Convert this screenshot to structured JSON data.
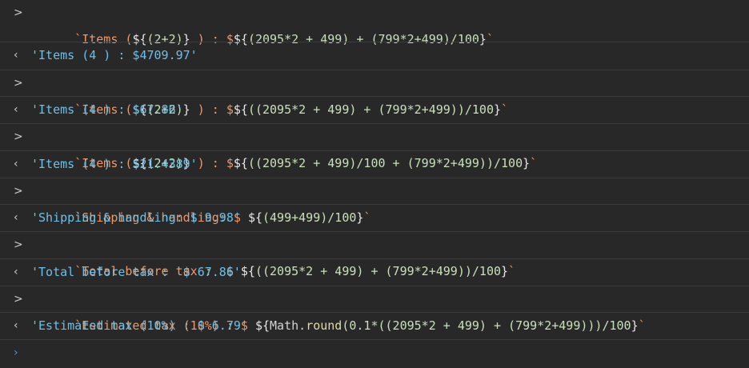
{
  "console": {
    "input_arrow": ">",
    "output_arrow": "‹",
    "prompt_arrow": "›",
    "entries": [
      {
        "kind": "input",
        "segments": [
          {
            "cls": "t-str",
            "text": "`Items ("
          },
          {
            "cls": "t-sym",
            "text": "${"
          },
          {
            "cls": "t-num",
            "text": "(2+2)"
          },
          {
            "cls": "t-sym",
            "text": "}"
          },
          {
            "cls": "t-str",
            "text": " ) : $"
          },
          {
            "cls": "t-sym",
            "text": "${"
          },
          {
            "cls": "t-num",
            "text": "(2095*2 + 499) + (799*2+499)/100"
          },
          {
            "cls": "t-sym",
            "text": "}"
          },
          {
            "cls": "t-str",
            "text": "`"
          }
        ]
      },
      {
        "kind": "output",
        "text": "'Items (4 ) : $4709.97'"
      },
      {
        "kind": "input",
        "segments": [
          {
            "cls": "t-str",
            "text": "`Items ("
          },
          {
            "cls": "t-sym",
            "text": "${"
          },
          {
            "cls": "t-num",
            "text": "(2+2)"
          },
          {
            "cls": "t-sym",
            "text": "}"
          },
          {
            "cls": "t-str",
            "text": " ) : $"
          },
          {
            "cls": "t-sym",
            "text": "${"
          },
          {
            "cls": "t-num",
            "text": "((2095*2 + 499) + (799*2+499))/100"
          },
          {
            "cls": "t-sym",
            "text": "}"
          },
          {
            "cls": "t-str",
            "text": "`"
          }
        ]
      },
      {
        "kind": "output",
        "text": "'Items (4 ) : $67.86'"
      },
      {
        "kind": "input",
        "segments": [
          {
            "cls": "t-str",
            "text": "`Items ("
          },
          {
            "cls": "t-sym",
            "text": "${"
          },
          {
            "cls": "t-num",
            "text": "(2+2)"
          },
          {
            "cls": "t-sym",
            "text": "}"
          },
          {
            "cls": "t-str",
            "text": " ) : $"
          },
          {
            "cls": "t-sym",
            "text": "${"
          },
          {
            "cls": "t-num",
            "text": "((2095*2 + 499)/100 + (799*2+499))/100"
          },
          {
            "cls": "t-sym",
            "text": "}"
          },
          {
            "cls": "t-str",
            "text": "`"
          }
        ]
      },
      {
        "kind": "output",
        "text": "'Items (4 ) : $21.4389'"
      },
      {
        "kind": "input",
        "segments": [
          {
            "cls": "t-str",
            "text": "`Shipping & handling: $ "
          },
          {
            "cls": "t-sym",
            "text": "${"
          },
          {
            "cls": "t-num",
            "text": "(499+499)/100"
          },
          {
            "cls": "t-sym",
            "text": "}"
          },
          {
            "cls": "t-str",
            "text": "`"
          }
        ]
      },
      {
        "kind": "output",
        "text": "'Shipping & handling: $ 9.98'"
      },
      {
        "kind": "input",
        "segments": [
          {
            "cls": "t-str",
            "text": "`Total before tax :  $ "
          },
          {
            "cls": "t-sym",
            "text": "${"
          },
          {
            "cls": "t-num",
            "text": "((2095*2 + 499) + (799*2+499))/100"
          },
          {
            "cls": "t-sym",
            "text": "}"
          },
          {
            "cls": "t-str",
            "text": "`"
          }
        ]
      },
      {
        "kind": "output",
        "text": "'Total before tax :  $ 67.86'"
      },
      {
        "kind": "input",
        "segments": [
          {
            "cls": "t-str",
            "text": "`Estimated tax (10%) : $ "
          },
          {
            "cls": "t-sym",
            "text": "${"
          },
          {
            "cls": "t-id",
            "text": "Math."
          },
          {
            "cls": "t-fn",
            "text": "round"
          },
          {
            "cls": "t-num",
            "text": "(0.1*((2095*2 + 499) + (799*2+499)))/100"
          },
          {
            "cls": "t-sym",
            "text": "}"
          },
          {
            "cls": "t-str",
            "text": "`"
          }
        ]
      },
      {
        "kind": "output",
        "text": "'Estimated tax (10%) : $ 6.79'"
      }
    ]
  }
}
